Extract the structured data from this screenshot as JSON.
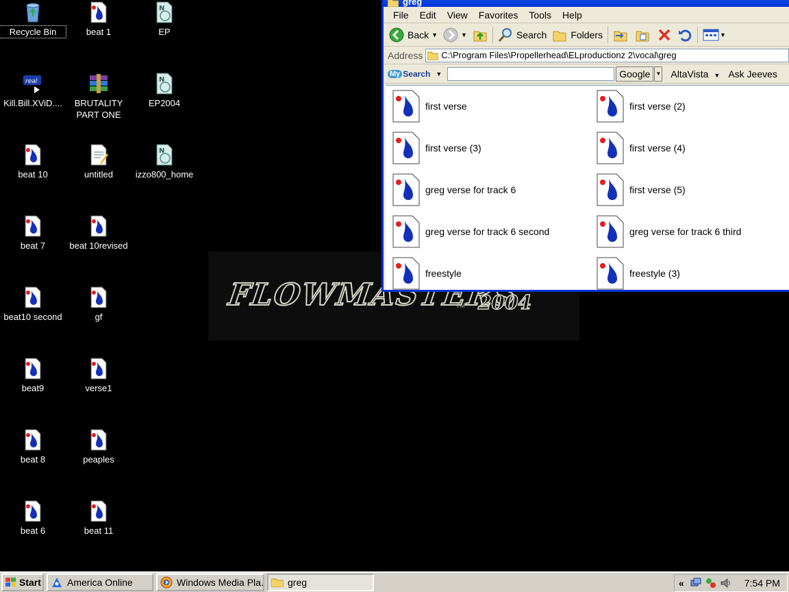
{
  "desktop": {
    "icons": [
      {
        "label": "Recycle Bin",
        "icon": "recycle-bin-icon"
      },
      {
        "label": "beat 1",
        "icon": "audio-file-icon"
      },
      {
        "label": "EP",
        "icon": "nero-file-icon"
      },
      {
        "label": "Kill.Bill.XViD....",
        "icon": "realplayer-file-icon"
      },
      {
        "label": "BRUTALITY\nPART ONE",
        "icon": "winrar-archive-icon"
      },
      {
        "label": "EP2004",
        "icon": "nero-file-icon"
      },
      {
        "label": "beat 10",
        "icon": "audio-file-icon"
      },
      {
        "label": "untitled",
        "icon": "text-document-icon"
      },
      {
        "label": "izzo800_home",
        "icon": "nero-file-icon"
      },
      {
        "label": "beat 7",
        "icon": "audio-file-icon"
      },
      {
        "label": "beat 10revised",
        "icon": "audio-file-icon"
      },
      {
        "label": "beat10 second",
        "icon": "audio-file-icon"
      },
      {
        "label": "gf",
        "icon": "audio-file-icon"
      },
      {
        "label": "beat9",
        "icon": "audio-file-icon"
      },
      {
        "label": "verse1",
        "icon": "audio-file-icon"
      },
      {
        "label": "beat 8",
        "icon": "audio-file-icon"
      },
      {
        "label": "peaples",
        "icon": "audio-file-icon"
      },
      {
        "label": "beat 6",
        "icon": "audio-file-icon"
      },
      {
        "label": "beat 11",
        "icon": "audio-file-icon"
      }
    ]
  },
  "wallpaper": {
    "logo": "FLOWMASTERS",
    "tm": "TM",
    "year": "2004"
  },
  "explorer": {
    "title": "greg",
    "menu": [
      "File",
      "Edit",
      "View",
      "Favorites",
      "Tools",
      "Help"
    ],
    "toolbar": {
      "back": "Back",
      "search": "Search",
      "folders": "Folders"
    },
    "address_label": "Address",
    "address_value": "C:\\Program Files\\Propellerhead\\ELproductionz 2\\vocal\\greg",
    "searchbar": {
      "brand_my": "My",
      "brand_rest": "Search",
      "google": "Google",
      "links": [
        "AltaVista",
        "Ask Jeeves"
      ]
    },
    "files": [
      "first verse",
      "first verse (2)",
      "first verse (3)",
      "first verse (4)",
      "greg verse for track 6",
      "first verse (5)",
      "greg verse for track 6 second",
      "greg verse for track 6 third",
      "freestyle",
      "freestyle (3)"
    ]
  },
  "taskbar": {
    "start": "Start",
    "tasks": [
      "America  Online",
      "Windows Media Pla...",
      "greg"
    ],
    "clock": "7:54 PM",
    "chevron": "«"
  },
  "colors": {
    "title_blue": "#0831d9",
    "desktop_bg": "#000000",
    "chrome": "#ece9d8"
  }
}
